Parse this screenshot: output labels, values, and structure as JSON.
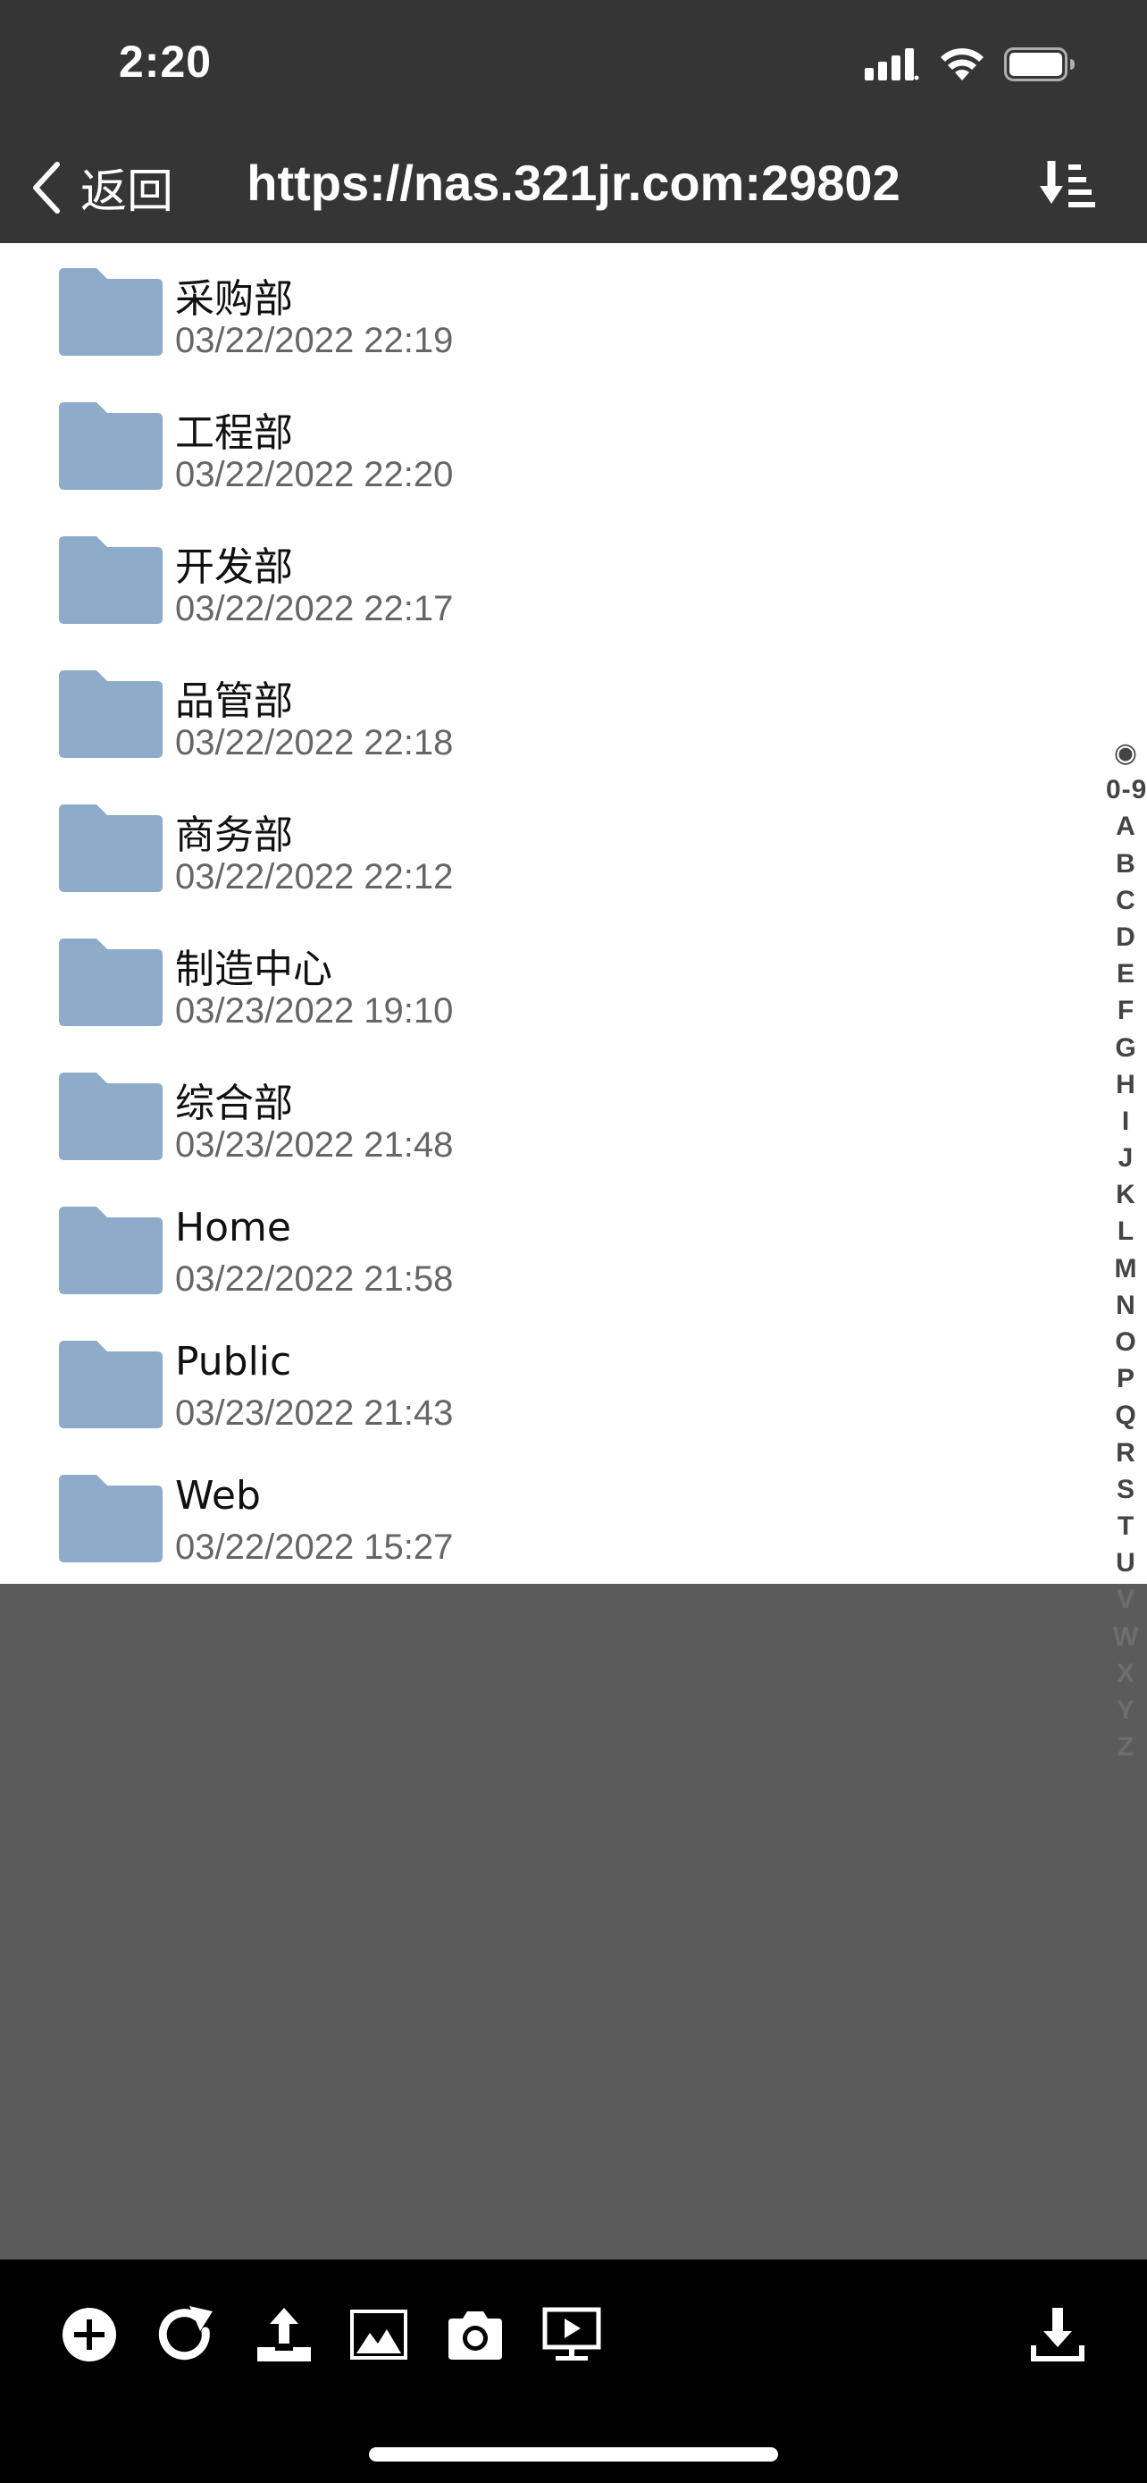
{
  "status_bar": {
    "time": "2:20",
    "icons": [
      "cellular-signal-icon",
      "wifi-icon",
      "battery-icon"
    ]
  },
  "nav": {
    "back_label": "返回",
    "title": "https://nas.321jr.com:29802",
    "sort_icon": "sort-icon"
  },
  "colors": {
    "header": "#353535",
    "folder": "#8eabc9",
    "toolbar": "#000000",
    "empty_area": "#5b5b5b"
  },
  "files": [
    {
      "name": "采购部",
      "date": "03/22/2022 22:19"
    },
    {
      "name": "工程部",
      "date": "03/22/2022 22:20"
    },
    {
      "name": "开发部",
      "date": "03/22/2022 22:17"
    },
    {
      "name": "品管部",
      "date": "03/22/2022 22:18"
    },
    {
      "name": "商务部",
      "date": "03/22/2022 22:12"
    },
    {
      "name": "制造中心",
      "date": "03/23/2022 19:10"
    },
    {
      "name": "综合部",
      "date": "03/23/2022 21:48"
    },
    {
      "name": "Home",
      "date": "03/22/2022 21:58"
    },
    {
      "name": "Public",
      "date": "03/23/2022 21:43"
    },
    {
      "name": "Web",
      "date": "03/22/2022 15:27"
    }
  ],
  "index_bar": [
    "◉",
    "0-9",
    "A",
    "B",
    "C",
    "D",
    "E",
    "F",
    "G",
    "H",
    "I",
    "J",
    "K",
    "L",
    "M",
    "N",
    "O",
    "P",
    "Q",
    "R",
    "S",
    "T",
    "U",
    "V",
    "W",
    "X",
    "Y",
    "Z"
  ],
  "toolbar": {
    "icons": [
      "add-icon",
      "refresh-icon",
      "upload-icon",
      "photo-library-icon",
      "camera-icon",
      "screen-share-icon",
      "download-icon"
    ]
  }
}
